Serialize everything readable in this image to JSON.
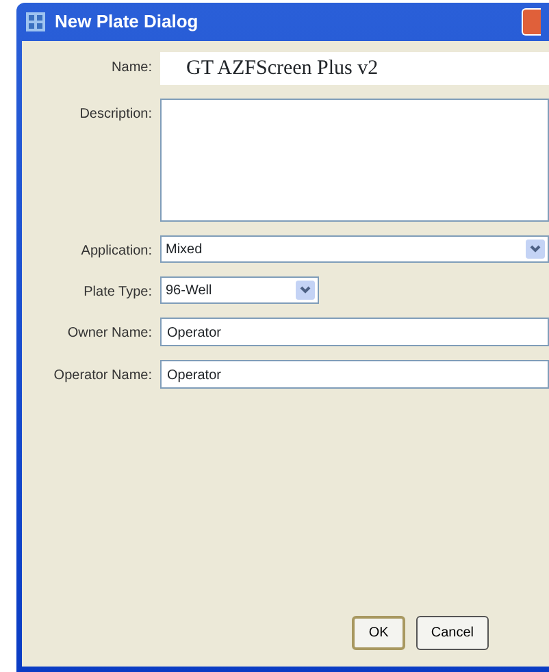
{
  "window": {
    "title": "New Plate Dialog"
  },
  "fields": [
    {
      "label": "Name:",
      "kind": "text",
      "value": "GT AZFScreen Plus v2"
    },
    {
      "label": "Description:",
      "kind": "textarea"
    },
    {
      "label": "Application:",
      "kind": "select",
      "value": "Mixed"
    },
    {
      "label": "Plate Type:",
      "kind": "select-short",
      "value": "96-Well"
    },
    {
      "label": "Owner Name:",
      "kind": "text",
      "value": "Operator"
    },
    {
      "label": "Operator Name:",
      "kind": "text",
      "value": "Operator"
    }
  ],
  "buttons": [
    "OK",
    "Cancel"
  ]
}
